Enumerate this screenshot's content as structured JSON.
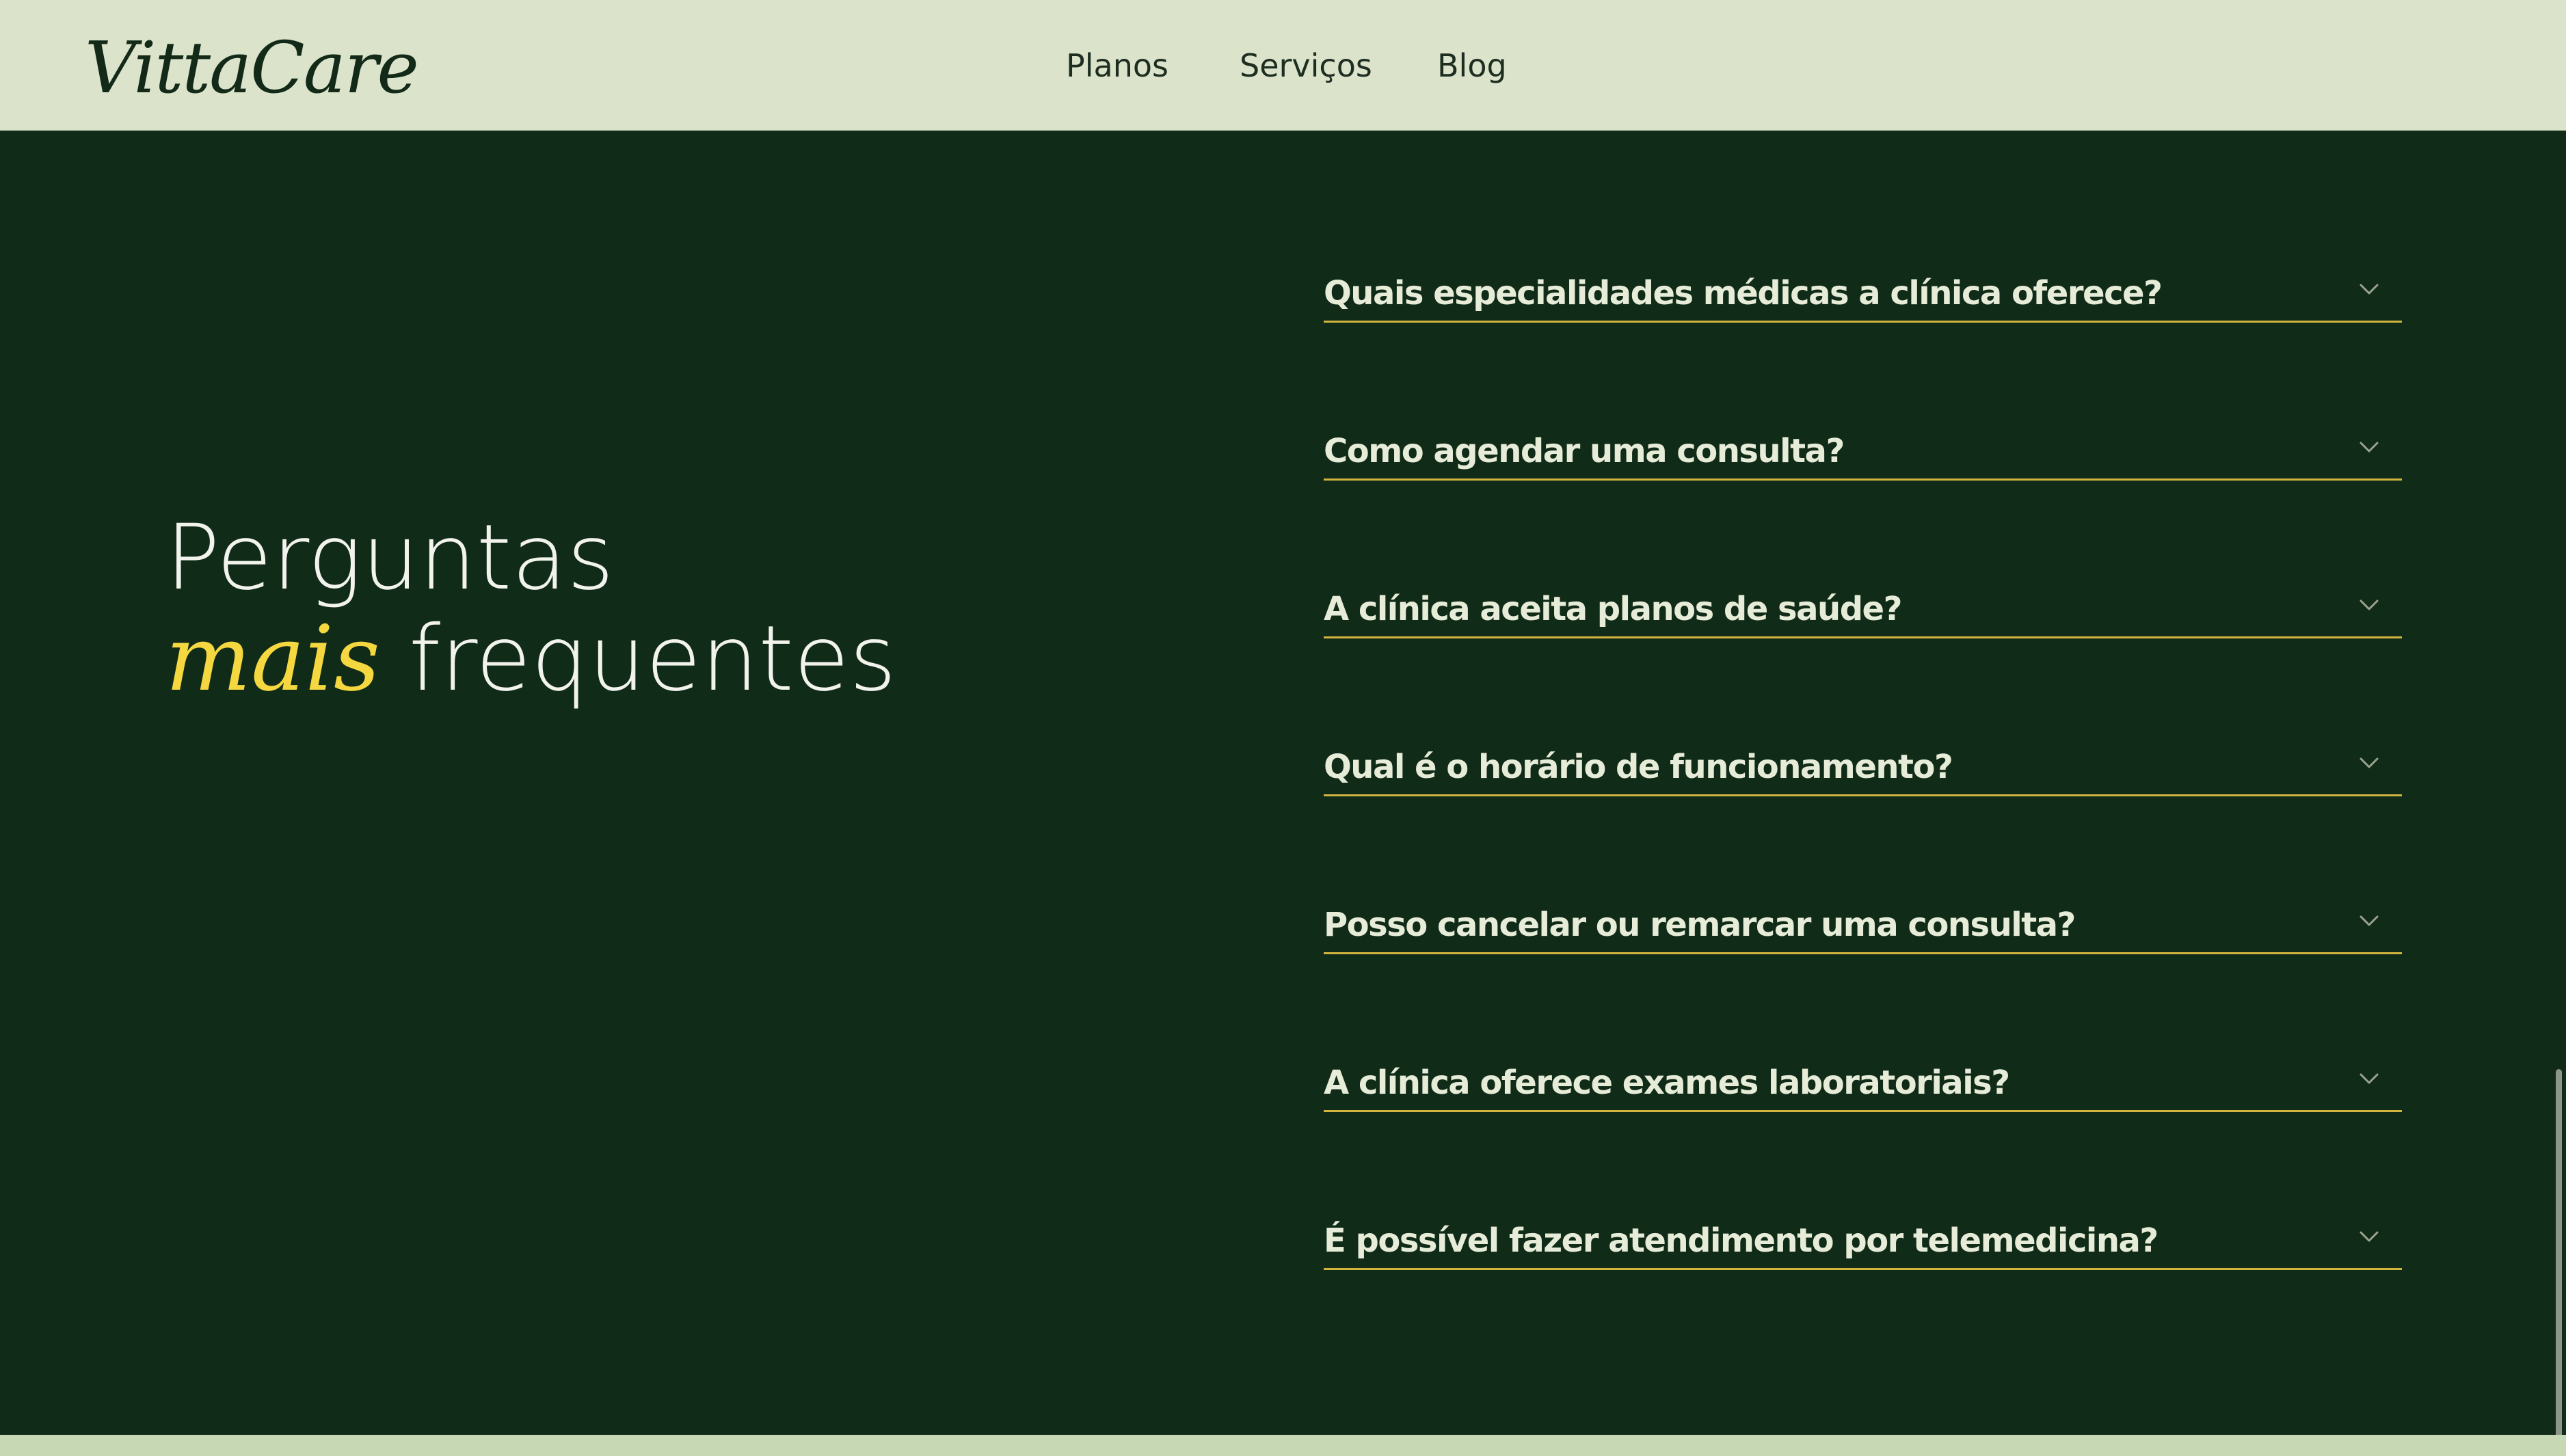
{
  "header": {
    "logo": "VittaCare",
    "nav": [
      {
        "label": "Planos"
      },
      {
        "label": "Serviços"
      },
      {
        "label": "Blog"
      }
    ]
  },
  "faq": {
    "title_line1": "Perguntas",
    "title_accent": "mais",
    "title_rest": " frequentes",
    "items": [
      {
        "question": "Quais especialidades médicas a clínica oferece?"
      },
      {
        "question": "Como agendar uma consulta?"
      },
      {
        "question": "A clínica aceita planos de saúde?"
      },
      {
        "question": "Qual é o horário de funcionamento?"
      },
      {
        "question": "Posso cancelar ou remarcar uma consulta?"
      },
      {
        "question": "A clínica oferece exames laboratoriais?"
      },
      {
        "question": "É possível fazer atendimento por telemedicina?"
      }
    ]
  },
  "colors": {
    "header_bg": "#dbe3cb",
    "section_bg": "#102b18",
    "accent_yellow": "#f5d840",
    "divider": "#d2b43e",
    "question_text": "#e6ecd8",
    "footer_strip": "#c7d8b4"
  },
  "icons": {
    "faq_toggle": "chevron-down-icon"
  }
}
